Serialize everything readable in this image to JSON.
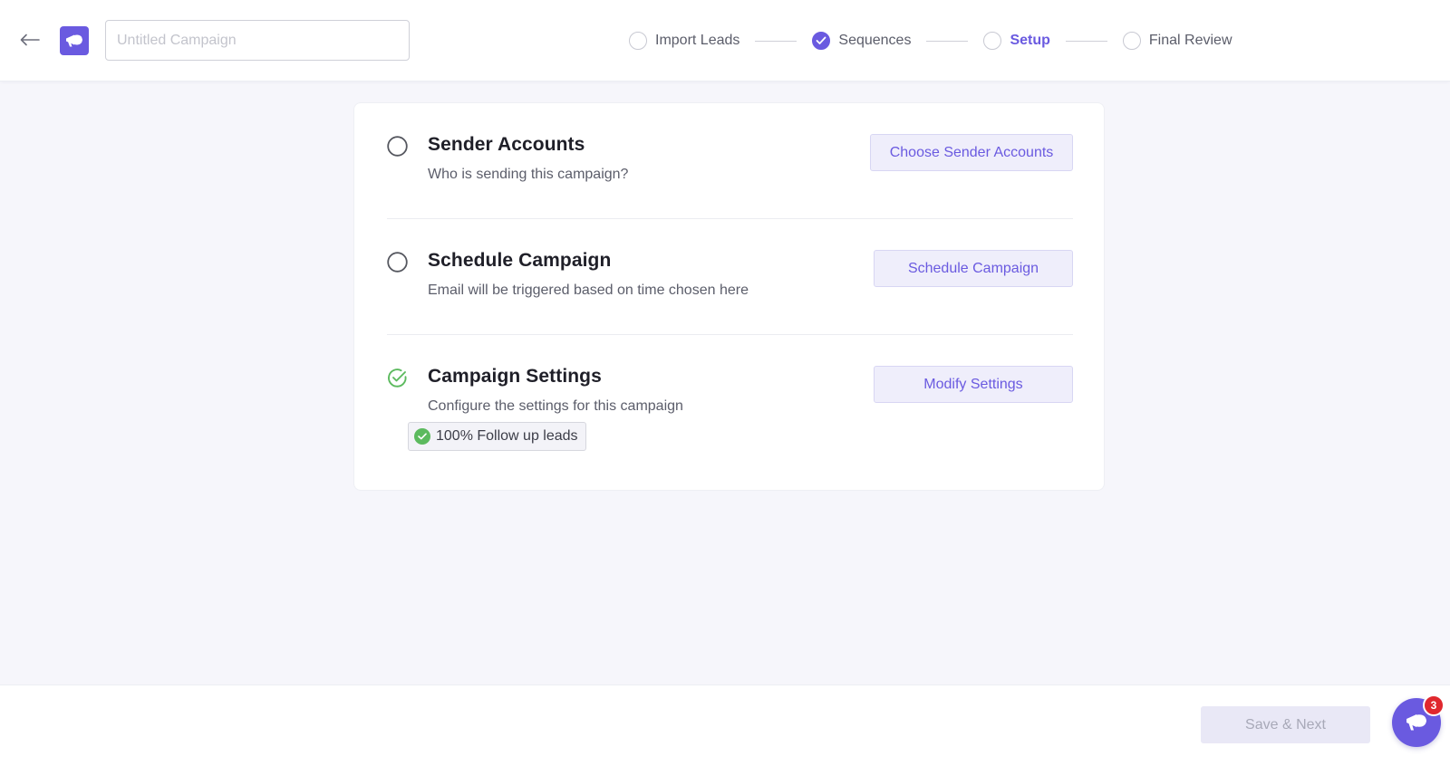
{
  "header": {
    "campaign_name": {
      "value": "",
      "placeholder": "Untitled Campaign"
    },
    "steps": [
      {
        "label": "Import Leads",
        "state": "pending"
      },
      {
        "label": "Sequences",
        "state": "done"
      },
      {
        "label": "Setup",
        "state": "active"
      },
      {
        "label": "Final Review",
        "state": "pending"
      }
    ]
  },
  "setup": {
    "sender_accounts": {
      "title": "Sender Accounts",
      "description": "Who is sending this campaign?",
      "button": "Choose Sender Accounts",
      "complete": false
    },
    "schedule": {
      "title": "Schedule Campaign",
      "description": "Email will be triggered based on time chosen here",
      "button": "Schedule Campaign",
      "complete": false
    },
    "settings": {
      "title": "Campaign Settings",
      "description": "Configure the settings for this campaign",
      "button": "Modify Settings",
      "complete": true,
      "chip": "100% Follow up leads"
    }
  },
  "footer": {
    "save_next": "Save & Next",
    "help_badge_count": "3"
  },
  "colors": {
    "accent": "#6a5ae0",
    "success": "#5cba5e",
    "badge": "#e0282e"
  }
}
